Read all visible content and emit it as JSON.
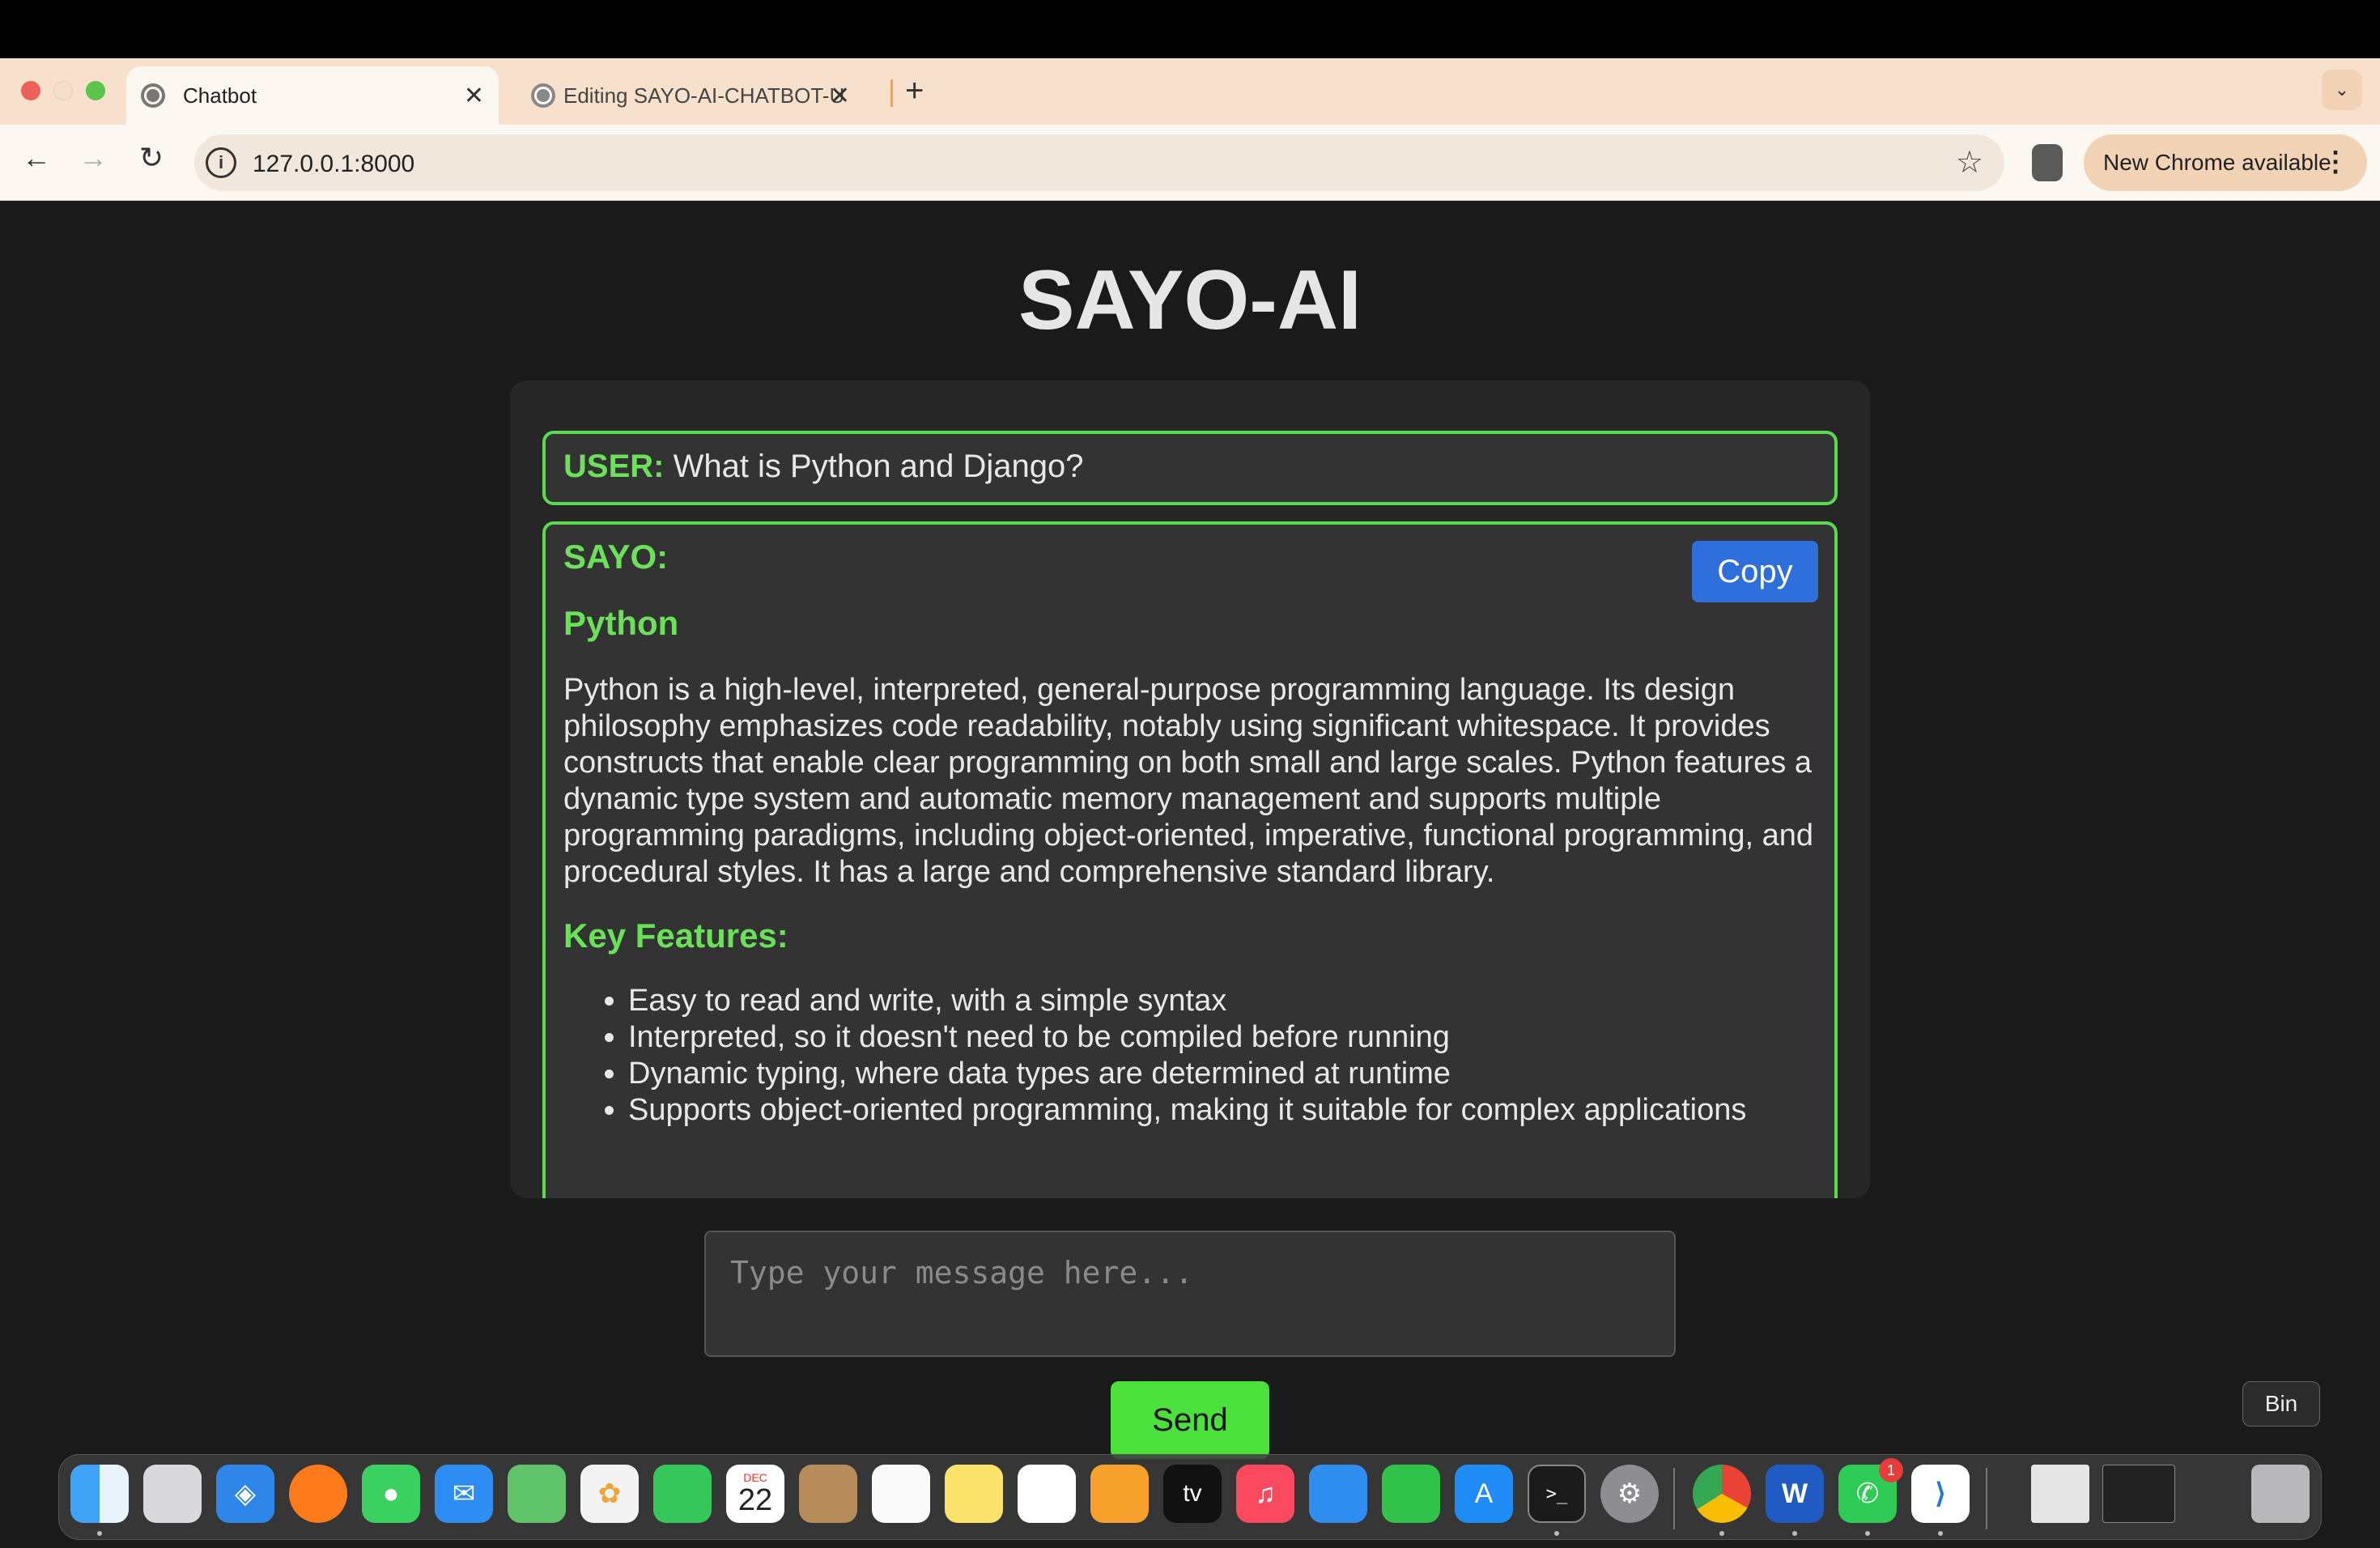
{
  "browser": {
    "tabs": [
      {
        "label": "Chatbot",
        "active": true
      },
      {
        "label": "Editing SAYO-AI-CHATBOT-U",
        "active": false
      }
    ],
    "new_tab_symbol": "+",
    "close_symbol": "✕",
    "url": "127.0.0.1:8000",
    "update_label": "New Chrome available"
  },
  "page": {
    "title": "SAYO-AI",
    "user_message": {
      "label": "USER:",
      "text": " What is Python and Django?"
    },
    "bot_message": {
      "label": "SAYO:",
      "copy_label": "Copy",
      "heading": "Python",
      "paragraph": "Python is a high-level, interpreted, general-purpose programming language. Its design philosophy emphasizes code readability, notably using significant whitespace. It provides constructs that enable clear programming on both small and large scales. Python features a dynamic type system and automatic memory management and supports multiple programming paradigms, including object-oriented, imperative, functional programming, and procedural styles. It has a large and comprehensive standard library.",
      "subheading": "Key Features:",
      "features": [
        "Easy to read and write, with a simple syntax",
        "Interpreted, so it doesn't need to be compiled before running",
        "Dynamic typing, where data types are determined at runtime",
        "Supports object-oriented programming, making it suitable for complex applications"
      ]
    },
    "input_placeholder": "Type your message here...",
    "send_label": "Send"
  },
  "dock": {
    "tooltip": "Bin",
    "calendar": {
      "month": "DEC",
      "day": "22"
    },
    "whatsapp_badge": "1",
    "tv_label": "tv",
    "icons": [
      "finder-icon",
      "launchpad-icon",
      "safari-icon",
      "firefox-icon",
      "messages-icon",
      "mail-icon",
      "maps-icon",
      "photos-icon",
      "facetime-icon",
      "calendar-icon",
      "contacts-icon",
      "reminders-icon",
      "notes-icon",
      "freeform-icon",
      "pages-icon",
      "appletv-icon",
      "music-icon",
      "keynote-icon",
      "numbers-icon",
      "appstore-icon",
      "terminal-icon",
      "settings-icon",
      "chrome-icon",
      "word-icon",
      "whatsapp-icon",
      "vscode-icon",
      "trash-icon"
    ]
  }
}
